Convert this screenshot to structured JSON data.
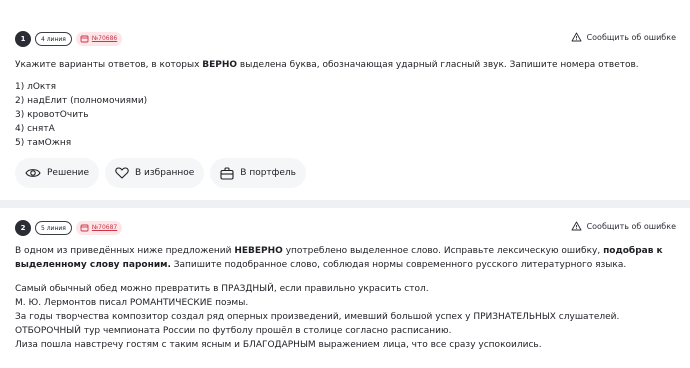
{
  "report_label": "Сообщить об ошибке",
  "tasks": [
    {
      "number": "1",
      "lines": "4 линия",
      "id": "№70686",
      "question_pre": "Укажите варианты ответов, в которых ",
      "question_bold": "ВЕРНО",
      "question_post": " выделена буква, обозначающая ударный гласный звук. Запишите номера ответов.",
      "options": [
        "1) лОктя",
        "2) надЕлит (полномочиями)",
        "3) кровотОчить",
        "4) снятА",
        "5) тамОжня"
      ]
    },
    {
      "number": "2",
      "lines": "5 линия",
      "id": "№70687",
      "question_pre": "В одном из приведённых ниже предложений ",
      "question_bold": "НЕВЕРНО",
      "question_mid": " употреблено выделенное слово. Исправьте лексическую ошибку, ",
      "question_bold2": "подобрав к выделенному слову пароним.",
      "question_post": " Запишите подобранное слово, соблюдая нормы современного русского литературного языка.",
      "options": [
        "Самый обычный обед можно превратить в ПРАЗДНЫЙ, если правильно украсить стол.",
        "М. Ю. Лермонтов писал РОМАНТИЧЕСКИЕ поэмы.",
        "За годы творчества композитор создал ряд оперных произведений, имевший большой успех у ПРИЗНАТЕЛЬНЫХ слушателей.",
        "ОТБОРОЧНЫЙ тур чемпионата России по футболу прошёл в столице согласно расписанию.",
        "Лиза пошла навстречу гостям с таким ясным и БЛАГОДАРНЫМ выражением лица, что все сразу успокоились."
      ]
    }
  ],
  "actions": {
    "solution": "Решение",
    "favorite": "В избранное",
    "portfolio": "В портфель"
  }
}
